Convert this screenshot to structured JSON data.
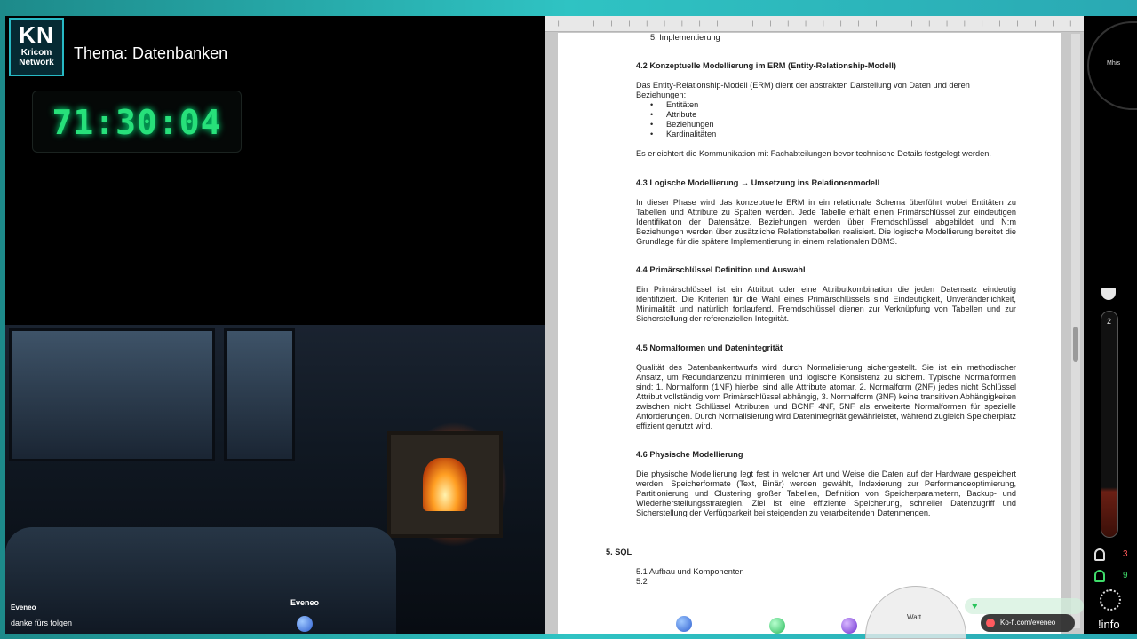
{
  "brand": {
    "logo_mark": "KN",
    "logo_sub1": "Kricom",
    "logo_sub2": "Network"
  },
  "topic": "Thema: Datenbanken",
  "timer": "71:30:04",
  "overlay": {
    "follow_label": "Eveneo",
    "follow_text": "danke fürs folgen",
    "center_label": "Eveneo",
    "watt": "Watt",
    "kofi": "Ko-fi.com/eveneo"
  },
  "right_panel": {
    "gauge_unit": "Mh/s",
    "tube_value": "2",
    "stat1": "3",
    "stat2": "9",
    "info": "!info"
  },
  "document": {
    "list_top": "5.   Implementierung",
    "s42": {
      "title": "4.2 Konzeptuelle Modellierung im ERM (Entity-Relationship-Modell)",
      "intro": "Das Entity-Relationship-Modell (ERM) dient der abstrakten Darstellung von Daten und deren Beziehungen:",
      "items": [
        "Entitäten",
        "Attribute",
        "Beziehungen",
        "Kardinalitäten"
      ],
      "outro": "Es erleichtert die Kommunikation mit Fachabteilungen bevor technische Details festgelegt werden."
    },
    "s43": {
      "title": "4.3 Logische Modellierung → Umsetzung ins Relationenmodell",
      "body": "In dieser Phase wird das konzeptuelle ERM in ein relationale Schema überführt wobei Entitäten zu Tabellen und Attribute zu Spalten werden. Jede Tabelle erhält einen Primärschlüssel zur eindeutigen Identifikation der Datensätze. Beziehungen werden über Fremdschlüssel abgebildet und N:m Beziehungen werden über zusätzliche Relationstabellen realisiert. Die logische Modellierung bereitet die Grundlage für die spätere Implementierung in einem relationalen DBMS."
    },
    "s44": {
      "title": "4.4 Primärschlüssel Definition und Auswahl",
      "body": "Ein Primärschlüssel ist ein Attribut oder eine Attributkombination die jeden Datensatz eindeutig identifiziert. Die Kriterien für die Wahl eines Primärschlüssels sind Eindeutigkeit, Unveränderlichkeit, Minimalität und natürlich fortlaufend. Fremdschlüssel dienen zur Verknüpfung von Tabellen und zur Sicherstellung der referenziellen Integrität."
    },
    "s45": {
      "title": "4.5 Normalformen und Datenintegrität",
      "body": "Qualität des Datenbankentwurfs wird durch Normalisierung sichergestellt. Sie ist ein methodischer Ansatz, um Redundanzenzu minimieren und logische Konsistenz zu sichern. Typische Normalformen sind: 1. Normalform (1NF) hierbei sind alle Attribute atomar, 2. Normalform (2NF) jedes nicht Schlüssel Attribut vollständig vom Primärschlüssel abhängig, 3. Normalform (3NF) keine transitiven Abhängigkeiten zwischen nicht Schlüssel Attributen und BCNF 4NF, 5NF als erweiterte Normalformen für spezielle Anforderungen. Durch Normalisierung wird Datenintegrität gewährleistet, während zugleich Speicherplatz effizient genutzt wird."
    },
    "s46": {
      "title": "4.6 Physische Modellierung",
      "body": "Die physische Modellierung legt fest in welcher Art und Weise die Daten auf der Hardware gespeichert werden. Speicherformate (Text, Binär) werden gewählt, Indexierung zur Performanceoptimierung, Partitionierung und Clustering großer Tabellen, Definition von Speicherparametern, Backup- und Wiederherstellungsstrategien. Ziel ist eine effiziente Speicherung, schneller Datenzugriff und Sicherstellung der Verfügbarkeit bei steigenden zu verarbeitenden Datenmengen."
    },
    "s5": {
      "title": "5. SQL",
      "sub1": "5.1 Aufbau und Komponenten",
      "sub2": "5.2"
    }
  },
  "colors": {
    "timer": "#27e07a",
    "frame": "#2fc3c3"
  }
}
